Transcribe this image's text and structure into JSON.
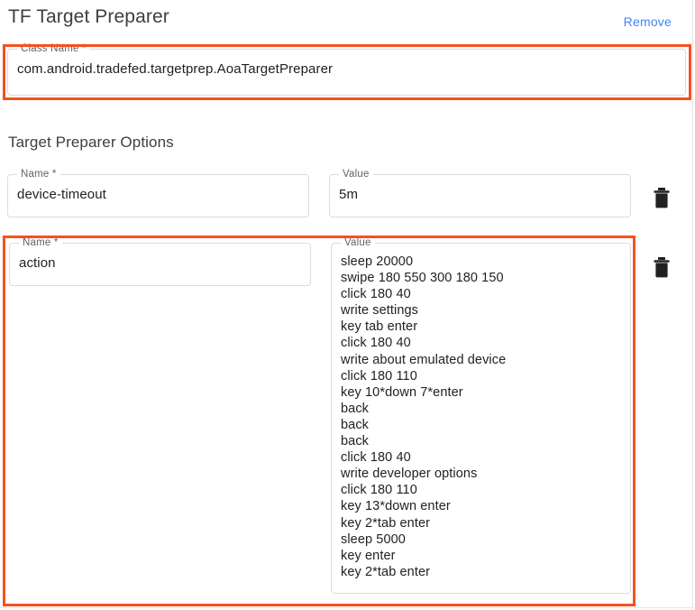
{
  "header": {
    "title": "TF Target Preparer",
    "remove_label": "Remove"
  },
  "class_name_field": {
    "legend": "Class Name *",
    "value": "com.android.tradefed.targetprep.AoaTargetPreparer"
  },
  "options_section": {
    "title": "Target Preparer Options",
    "options": [
      {
        "name_legend": "Name *",
        "name_value": "device-timeout",
        "value_legend": "Value",
        "value_value": "5m",
        "delete_icon": "trash-icon"
      },
      {
        "name_legend": "Name *",
        "name_value": "action",
        "value_legend": "Value",
        "value_value": "sleep 20000\nswipe 180 550 300 180 150\nclick 180 40\nwrite settings\nkey tab enter\nclick 180 40\nwrite about emulated device\nclick 180 110\nkey 10*down 7*enter\nback\nback\nback\nclick 180 40\nwrite developer options\nclick 180 110\nkey 13*down enter\nkey 2*tab enter\nsleep 5000\nkey enter\nkey 2*tab enter",
        "delete_icon": "trash-icon"
      }
    ]
  },
  "annotations": {
    "highlight_color": "#f4511e",
    "boxes": [
      "class-name-field",
      "option-row-action"
    ]
  },
  "colors": {
    "link": "#4285f4",
    "text_primary": "#202124",
    "text_secondary": "#5f6368",
    "field_border": "#dadce0",
    "highlight": "#f4511e"
  }
}
